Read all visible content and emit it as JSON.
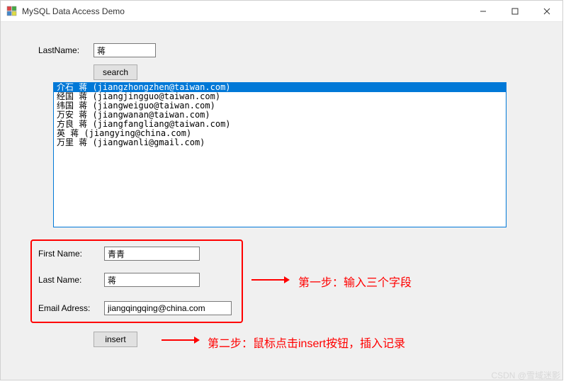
{
  "window": {
    "title": "MySQL Data Access Demo"
  },
  "search": {
    "label": "LastName:",
    "value": "蒋",
    "button": "search"
  },
  "list": {
    "items": [
      "介石 蒋 (jiangzhongzhen@taiwan.com)",
      "经国 蒋 (jiangjingguo@taiwan.com)",
      "纬国 蒋 (jiangweiguo@taiwan.com)",
      "万安 蒋 (jiangwanan@taiwan.com)",
      "方良 蒋 (jiangfangliang@taiwan.com)",
      "英 蒋 (jiangying@china.com)",
      "万里 蒋 (jiangwanli@gmail.com)"
    ],
    "selected_index": 0
  },
  "form": {
    "first_name_label": "First Name:",
    "first_name_value": "青青",
    "last_name_label": "Last Name:",
    "last_name_value": "蒋",
    "email_label": "Email Adress:",
    "email_value": "jiangqingqing@china.com",
    "insert_button": "insert"
  },
  "annotations": {
    "step1": "第一步：输入三个字段",
    "step2": "第二步：鼠标点击insert按钮，插入记录"
  },
  "watermark": "CSDN @雪域迷影"
}
